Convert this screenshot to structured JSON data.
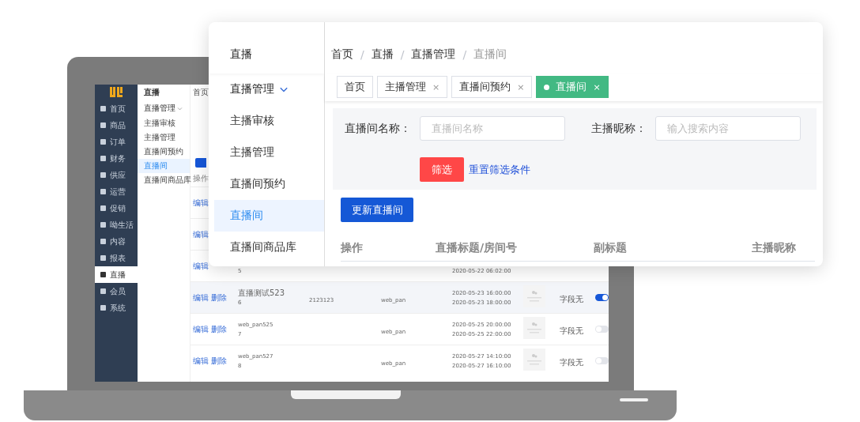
{
  "laptop_screen": {
    "sidebar": {
      "items": [
        {
          "label": "首页",
          "selected": false
        },
        {
          "label": "商品",
          "selected": false
        },
        {
          "label": "订单",
          "selected": false
        },
        {
          "label": "财务",
          "selected": false
        },
        {
          "label": "供应",
          "selected": false
        },
        {
          "label": "运营",
          "selected": false
        },
        {
          "label": "促销",
          "selected": false
        },
        {
          "label": "呦生活",
          "selected": false
        },
        {
          "label": "内容",
          "selected": false
        },
        {
          "label": "报表",
          "selected": false
        },
        {
          "label": "直播",
          "selected": true
        },
        {
          "label": "会员",
          "selected": false
        },
        {
          "label": "系统",
          "selected": false
        }
      ]
    },
    "submenu": {
      "title": "直播",
      "group": {
        "label": "直播管理",
        "expanded": true
      },
      "items": [
        {
          "label": "主播审核",
          "selected": false
        },
        {
          "label": "主播管理",
          "selected": false
        },
        {
          "label": "直播间预约",
          "selected": false
        },
        {
          "label": "直播间",
          "selected": true
        },
        {
          "label": "直播间商品库",
          "selected": false
        }
      ]
    },
    "breadcrumb": [
      "首页"
    ],
    "table": {
      "columns": [
        "操作"
      ],
      "rows": [
        {
          "actions": [
            "编辑"
          ],
          "highlighted": false
        },
        {
          "actions": [
            "编辑"
          ],
          "highlighted": false
        },
        {
          "actions": [
            "编辑"
          ],
          "number": "5",
          "end": "2020-05-22 06:02:00",
          "highlighted": false
        },
        {
          "actions": [
            "编辑",
            "删除"
          ],
          "title": "直播测试523",
          "number": "6",
          "room_id": "2123123",
          "anchor": "web_pan",
          "start": "2020-05-23 16:00:00",
          "end": "2020-05-23 18:00:00",
          "image": true,
          "subtitle": "字段无",
          "live": true,
          "highlighted": true
        },
        {
          "actions": [
            "编辑",
            "删除"
          ],
          "title": "web_pan525",
          "number": "7",
          "anchor": "web_pan",
          "start": "2020-05-25 20:00:00",
          "end": "2020-05-25 22:00:00",
          "image": true,
          "subtitle": "字段无",
          "live": false,
          "highlighted": false
        },
        {
          "actions": [
            "编辑",
            "删除"
          ],
          "title": "web_pan527",
          "number": "8",
          "anchor": "web_pan",
          "start": "2020-05-27 14:10:00",
          "end": "2020-05-27 16:10:00",
          "image": true,
          "subtitle": "字段无",
          "live": false,
          "highlighted": false
        }
      ]
    }
  },
  "panel": {
    "menu": {
      "title": "直播",
      "group": {
        "label": "直播管理",
        "expanded": true
      },
      "items": [
        {
          "label": "主播审核",
          "selected": false
        },
        {
          "label": "主播管理",
          "selected": false
        },
        {
          "label": "直播间预约",
          "selected": false
        },
        {
          "label": "直播间",
          "selected": true
        },
        {
          "label": "直播间商品库",
          "selected": false
        }
      ]
    },
    "breadcrumb": {
      "items": [
        "首页",
        "直播",
        "直播管理",
        "直播间"
      ],
      "separator": "/"
    },
    "tabs": [
      {
        "label": "首页",
        "selected": false
      },
      {
        "label": "主播管理",
        "close": "×",
        "selected": false
      },
      {
        "label": "直播间预约",
        "close": "×",
        "selected": false
      },
      {
        "label": "直播间",
        "close": "×",
        "selected": true
      }
    ],
    "filters": [
      {
        "label": "直播间名称：",
        "placeholder": "直播间名称"
      },
      {
        "label": "主播昵称：",
        "placeholder": "输入搜索内容"
      }
    ],
    "filter_button": "筛选",
    "reset_link": "重置筛选条件",
    "update_button": "更新直播间",
    "table": {
      "columns": [
        "操作",
        "直播标题/房间号",
        "副标题",
        "主播昵称"
      ]
    }
  }
}
